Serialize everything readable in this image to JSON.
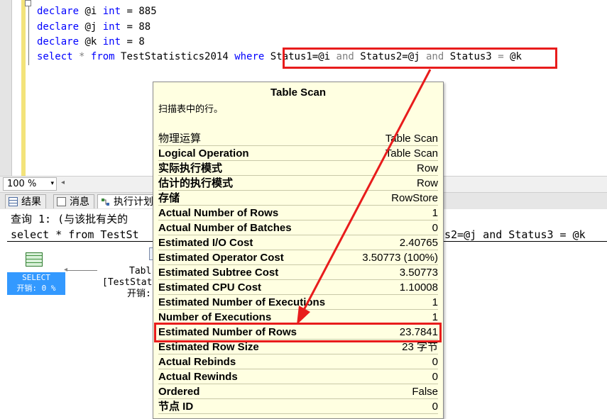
{
  "editor": {
    "lines": [
      {
        "kw": "declare",
        "var": "@i",
        "type": "int",
        "rest": "= 885"
      },
      {
        "kw": "declare",
        "var": "@j",
        "type": "int",
        "rest": "= 88"
      },
      {
        "kw": "declare",
        "var": "@k",
        "type": "int",
        "rest": "= 8"
      }
    ],
    "select_line": {
      "select": "select",
      "star": "*",
      "from": "from",
      "table": "TestStatistics2014",
      "where": "where",
      "c1": "Status1=@i",
      "and1": "and",
      "c2": "Status2=@j",
      "and2": "and",
      "c3": "Status3",
      "eq": "=",
      "c3v": "@k"
    }
  },
  "zoom": {
    "value": "100 %",
    "arrow": "▾",
    "scroll_left": "◂"
  },
  "tabs": [
    {
      "label": "结果",
      "icon": "grid-icon"
    },
    {
      "label": "消息",
      "icon": "message-icon"
    },
    {
      "label": "执行计划",
      "icon": "execution-plan-icon"
    }
  ],
  "plan": {
    "query_line": "查询 1: (与该批有关的",
    "select_line_left": "select * from TestSt",
    "select_line_right": "s2=@j and Status3 = @k",
    "select_node": {
      "label": "SELECT",
      "cost": "开销: 0 %"
    },
    "scan_node": {
      "line1": "Tabl",
      "line2": "[TestStat",
      "line3": "开销:"
    }
  },
  "tooltip": {
    "title": "Table Scan",
    "description": "扫描表中的行。",
    "rows": [
      {
        "label": "物理运算",
        "value": "Table Scan"
      },
      {
        "label": "Logical Operation",
        "value": "Table Scan"
      },
      {
        "label": "实际执行模式",
        "value": "Row"
      },
      {
        "label": "估计的执行模式",
        "value": "Row"
      },
      {
        "label": "存储",
        "value": "RowStore"
      },
      {
        "label": "Actual Number of Rows",
        "value": "1"
      },
      {
        "label": "Actual Number of Batches",
        "value": "0"
      },
      {
        "label": "Estimated I/O Cost",
        "value": "2.40765"
      },
      {
        "label": "Estimated Operator Cost",
        "value": "3.50773 (100%)"
      },
      {
        "label": "Estimated Subtree Cost",
        "value": "3.50773"
      },
      {
        "label": "Estimated CPU Cost",
        "value": "1.10008"
      },
      {
        "label": "Estimated Number of Executions",
        "value": "1"
      },
      {
        "label": "Number of Executions",
        "value": "1"
      },
      {
        "label": "Estimated Number of Rows",
        "value": "23.7841"
      },
      {
        "label": "Estimated Row Size",
        "value": "23 字节"
      },
      {
        "label": "Actual Rebinds",
        "value": "0"
      },
      {
        "label": "Actual Rewinds",
        "value": "0"
      },
      {
        "label": "Ordered",
        "value": "False"
      },
      {
        "label": "节点 ID",
        "value": "0"
      }
    ]
  },
  "colors": {
    "highlight": "#e81c1c",
    "keyword": "#0000ff",
    "operator": "#808080",
    "tooltip_bg": "#ffffe1",
    "selected_node": "#3399ff"
  }
}
